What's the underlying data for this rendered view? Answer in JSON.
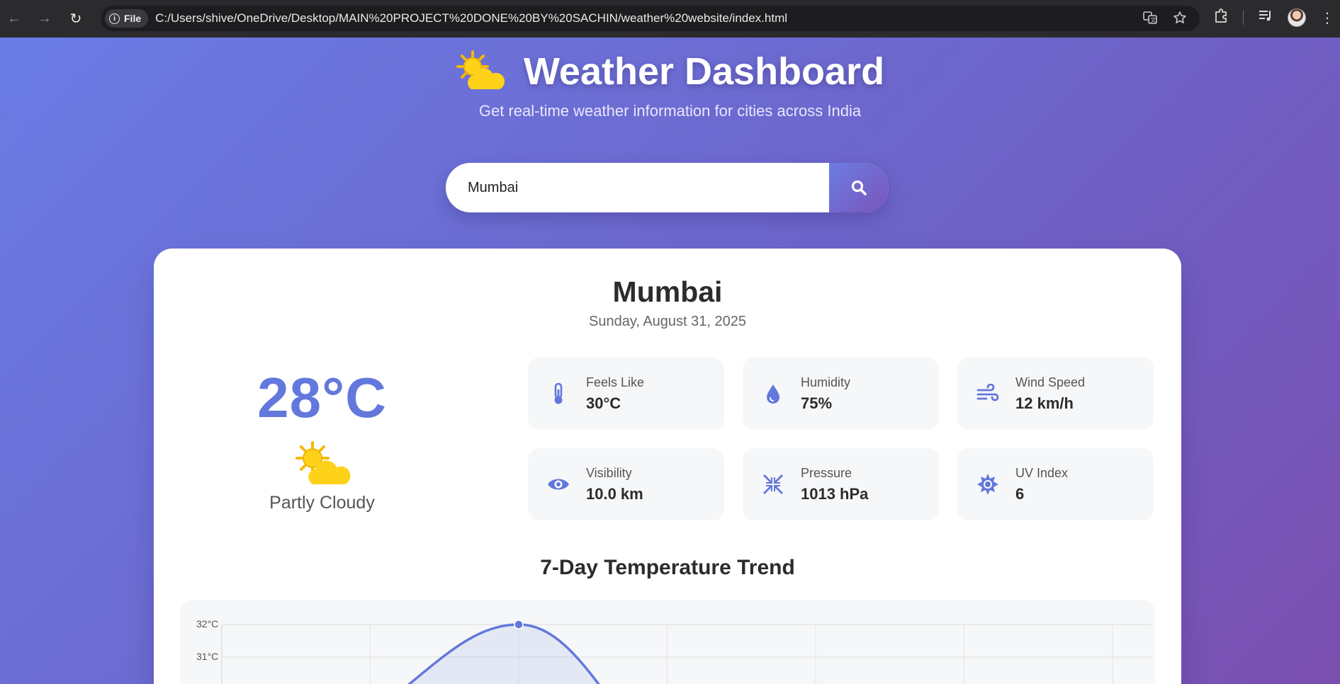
{
  "browser": {
    "file_chip": "File",
    "url": "C:/Users/shive/OneDrive/Desktop/MAIN%20PROJECT%20DONE%20BY%20SACHIN/weather%20website/index.html"
  },
  "header": {
    "title": "Weather Dashboard",
    "subtitle": "Get real-time weather information for cities across India"
  },
  "search": {
    "value": "Mumbai"
  },
  "weather": {
    "city": "Mumbai",
    "date": "Sunday, August 31, 2025",
    "temperature": "28°C",
    "condition": "Partly Cloudy",
    "stats": [
      {
        "icon": "thermometer-icon",
        "label": "Feels Like",
        "value": "30°C"
      },
      {
        "icon": "droplet-icon",
        "label": "Humidity",
        "value": "75%"
      },
      {
        "icon": "wind-icon",
        "label": "Wind Speed",
        "value": "12 km/h"
      },
      {
        "icon": "eye-icon",
        "label": "Visibility",
        "value": "10.0 km"
      },
      {
        "icon": "compress-icon",
        "label": "Pressure",
        "value": "1013 hPa"
      },
      {
        "icon": "sun-icon",
        "label": "UV Index",
        "value": "6"
      }
    ]
  },
  "trend": {
    "title": "7-Day Temperature Trend"
  },
  "chart_data": {
    "type": "line",
    "title": "",
    "y_tick_labels": [
      "32°C",
      "31°C"
    ],
    "visible_points": [
      {
        "index": 2,
        "y": 32
      }
    ],
    "ylim": [
      null,
      32
    ],
    "grid": true,
    "accent": "#6378dc"
  },
  "colors": {
    "accent": "#6378dc",
    "gradient_start": "#6a7de6",
    "gradient_end": "#7a4fb0"
  }
}
